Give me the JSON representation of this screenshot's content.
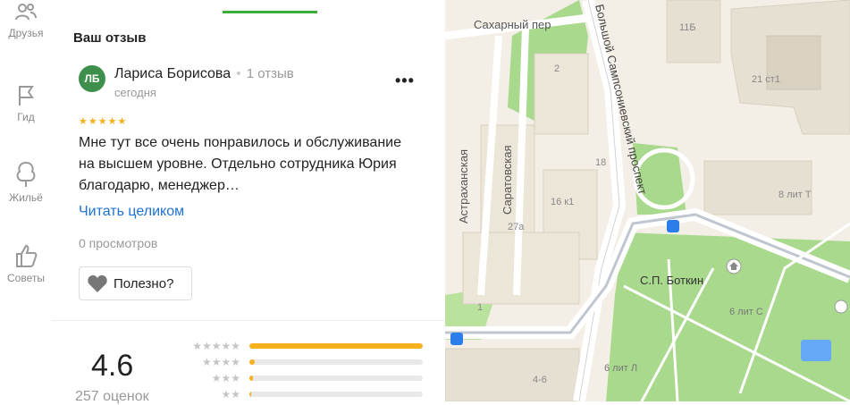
{
  "sidebar": {
    "items": [
      {
        "label": "Друзья",
        "icon": "friends-icon"
      },
      {
        "label": "Гид",
        "icon": "flag-icon"
      },
      {
        "label": "Жильё",
        "icon": "housing-icon"
      },
      {
        "label": "Советы",
        "icon": "thumb-up-icon"
      }
    ]
  },
  "review": {
    "section_title": "Ваш отзыв",
    "avatar_initials": "ЛБ",
    "author": "Лариса Борисова",
    "author_reviews": "1 отзыв",
    "date": "сегодня",
    "stars": "★★★★★",
    "rating": 5,
    "text": "Мне тут все очень понравилось и обслуживание на высшем уровне. Отдельно сотрудника Юрия благодарю, менеджер…",
    "read_more": "Читать целиком",
    "views": "0 просмотров",
    "helpful_label": "Полезно?"
  },
  "summary": {
    "rating": "4.6",
    "count": "257 оценок",
    "distribution": [
      {
        "stars": "★★★★★",
        "fraction": 1.0
      },
      {
        "stars": "★★★★",
        "fraction": 0.03
      },
      {
        "stars": "★★★",
        "fraction": 0.02
      },
      {
        "stars": "★★",
        "fraction": 0.01
      }
    ]
  },
  "map": {
    "labels": {
      "sakharny": "Сахарный пер",
      "samsonievsky": "Большой Сампсониевский проспект",
      "astrakhanskaya": "Астраханская",
      "saratovskaya": "Саратовская",
      "botkin": "С.П. Боткин",
      "b11": "11Б",
      "b21": "21 ст1",
      "b2": "2",
      "b18": "18",
      "b16": "16 к1",
      "b27a": "27а",
      "b1": "1",
      "b8": "8 лит Т",
      "b6c": "6 лит С",
      "b6l": "6 лит Л",
      "b46": "4-6"
    },
    "colors": {
      "park": "#a8d98c",
      "water": "#66aaf5",
      "road": "#ffffff",
      "land": "#f3efe6",
      "building": "#e6e0d2"
    }
  }
}
